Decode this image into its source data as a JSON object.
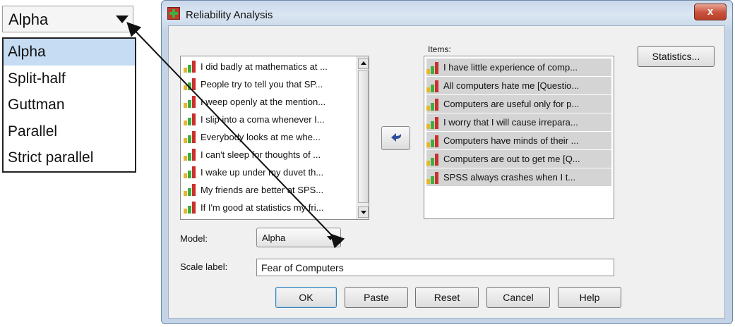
{
  "zoom": {
    "combo_value": "Alpha",
    "options": [
      "Alpha",
      "Split-half",
      "Guttman",
      "Parallel",
      "Strict parallel"
    ],
    "selected_index": 0
  },
  "dialog": {
    "title": "Reliability Analysis",
    "close_label": "x",
    "variables": [
      "I did badly at mathematics at ...",
      "People try to tell you that SP...",
      "I weep openly at the mention...",
      "I slip into a coma whenever I...",
      "Everybody looks at me whe...",
      "I can't sleep for thoughts of ...",
      "I wake up under my duvet th...",
      "My friends are better at SPS...",
      "If I'm good at statistics my fri..."
    ],
    "items_label": "Items:",
    "items": [
      "I have little experience of comp...",
      "All computers hate me [Questio...",
      "Computers are useful only for p...",
      "I worry that I will cause irrepara...",
      "Computers have minds of their ...",
      "Computers are out to get me [Q...",
      "SPSS always crashes when I t..."
    ],
    "statistics_button": "Statistics...",
    "model_label": "Model:",
    "model_value": "Alpha",
    "scale_label": "Scale label:",
    "scale_value": "Fear of Computers",
    "buttons": {
      "ok": "OK",
      "paste": "Paste",
      "reset": "Reset",
      "cancel": "Cancel",
      "help": "Help"
    }
  },
  "icons": {
    "variable_icon": "scale-measure-icon",
    "move_icon": "move-left-arrow-icon",
    "app_icon": "spss-dialog-icon"
  },
  "colors": {
    "selection": "#c5dcf2",
    "items_highlight": "#d4d4d4",
    "close_button": "#c9503a",
    "arrow_blue": "#2f4f9e"
  }
}
